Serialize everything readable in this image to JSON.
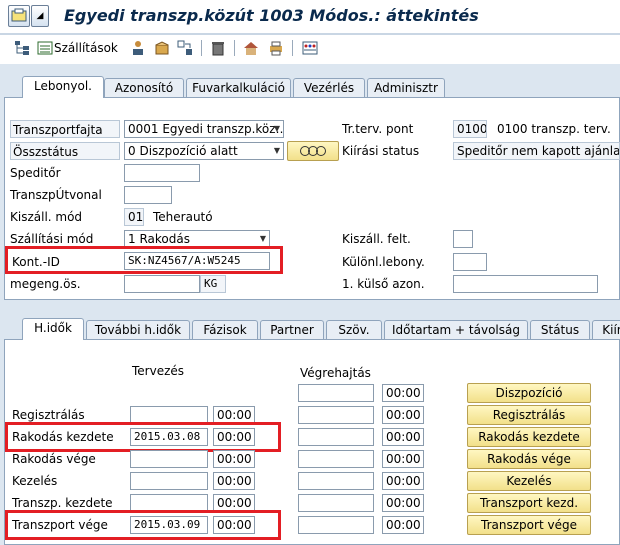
{
  "title": "Egyedi transzp.közút 1003 Módos.: áttekintés",
  "toolbar": {
    "shipments_label": "Szállítások"
  },
  "top_tabs": [
    "Lebonyol.",
    "Azonosító",
    "Fuvarkalkuláció",
    "Vezérlés",
    "Adminisztr"
  ],
  "general": {
    "transport_type_label": "Transzportfajta",
    "transport_type_value": "0001 Egyedi transzp.köz…",
    "overall_status_label": "Összstátus",
    "overall_status_value": "0 Diszpozíció alatt",
    "forwarder_label": "Speditőr",
    "route_label": "TranszpÚtvonal",
    "ship_mode_label": "Kiszáll. mód",
    "ship_mode_code": "01",
    "ship_mode_text": "Teherautó",
    "shipping_type_label": "Szállítási mód",
    "shipping_type_value": "1 Rakodás",
    "cont_id_label": "Kont.-ID",
    "cont_id_value": "SK:NZ4567/A:W5245",
    "allowed_weight_label": "megeng.ös.",
    "allowed_weight_unit": "KG",
    "planning_point_label": "Tr.terv. pont",
    "planning_point_code": "0100",
    "planning_point_text": "0100 transzp. terv.",
    "issue_status_label": "Kiírási status",
    "issue_status_value": "Speditőr nem kapott ajánlat…",
    "ship_cond_label": "Kiszáll. felt.",
    "special_proc_label": "Különl.lebony.",
    "external_id_label": "1. külső azon."
  },
  "lower_tabs": [
    "H.idők",
    "További h.idők",
    "Fázisok",
    "Partner",
    "Szöv.",
    "Időtartam + távolság",
    "Státus",
    "Kiír"
  ],
  "deadlines": {
    "planning_header": "Tervezés",
    "execution_header": "Végrehajtás",
    "rows": [
      {
        "label": "",
        "plan_date": "",
        "plan_time": "",
        "exec_date": "",
        "exec_time": "00:00",
        "button": "Diszpozíció"
      },
      {
        "label": "Regisztrálás",
        "plan_date": "",
        "plan_time": "00:00",
        "exec_date": "",
        "exec_time": "00:00",
        "button": "Regisztrálás"
      },
      {
        "label": "Rakodás kezdete",
        "plan_date": "2015.03.08",
        "plan_time": "00:00",
        "exec_date": "",
        "exec_time": "00:00",
        "button": "Rakodás kezdete"
      },
      {
        "label": "Rakodás vége",
        "plan_date": "",
        "plan_time": "00:00",
        "exec_date": "",
        "exec_time": "00:00",
        "button": "Rakodás vége"
      },
      {
        "label": "Kezelés",
        "plan_date": "",
        "plan_time": "00:00",
        "exec_date": "",
        "exec_time": "00:00",
        "button": "Kezelés"
      },
      {
        "label": "Transzp. kezdete",
        "plan_date": "",
        "plan_time": "00:00",
        "exec_date": "",
        "exec_time": "00:00",
        "button": "Transzport kezd."
      },
      {
        "label": "Transzport vége",
        "plan_date": "2015.03.09",
        "plan_time": "00:00",
        "exec_date": "",
        "exec_time": "00:00",
        "button": "Transzport vége"
      }
    ]
  }
}
